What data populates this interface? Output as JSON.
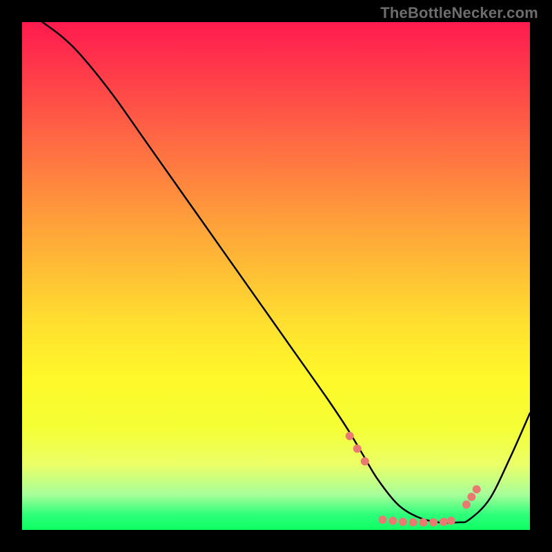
{
  "watermark": "TheBottleNecker.com",
  "chart_data": {
    "type": "line",
    "title": "",
    "xlabel": "",
    "ylabel": "",
    "xlim": [
      0,
      100
    ],
    "ylim": [
      0,
      100
    ],
    "grid": false,
    "note": "Axes are unlabeled; values are percentage positions inferred from pixel placement.",
    "series": [
      {
        "name": "bottleneck-curve",
        "color": "#000000",
        "stroke_width": 2.5,
        "x": [
          4,
          8,
          12,
          18,
          24,
          30,
          36,
          42,
          48,
          54,
          60,
          64,
          67,
          70,
          74,
          78,
          82,
          86,
          88,
          92,
          96,
          100
        ],
        "y": [
          100,
          97,
          93,
          85.5,
          77,
          68.5,
          60,
          51.5,
          43,
          34.5,
          26,
          20,
          15,
          10,
          5,
          2.5,
          1.5,
          1.5,
          2,
          6,
          14,
          23
        ]
      }
    ],
    "markers": {
      "name": "highlight-dots",
      "color": "#e97a72",
      "radius": 6,
      "points": [
        {
          "x": 64.5,
          "y": 18.5
        },
        {
          "x": 66.0,
          "y": 16.0
        },
        {
          "x": 67.5,
          "y": 13.5
        },
        {
          "x": 71.0,
          "y": 2.0
        },
        {
          "x": 73.0,
          "y": 1.8
        },
        {
          "x": 75.0,
          "y": 1.6
        },
        {
          "x": 77.0,
          "y": 1.5
        },
        {
          "x": 79.0,
          "y": 1.5
        },
        {
          "x": 81.0,
          "y": 1.5
        },
        {
          "x": 83.0,
          "y": 1.6
        },
        {
          "x": 84.5,
          "y": 1.8
        },
        {
          "x": 87.5,
          "y": 5.0
        },
        {
          "x": 88.5,
          "y": 6.5
        },
        {
          "x": 89.5,
          "y": 8.0
        }
      ]
    }
  }
}
